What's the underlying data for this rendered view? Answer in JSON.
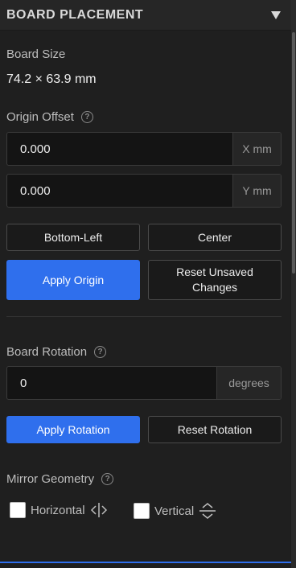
{
  "header": {
    "title": "BOARD PLACEMENT",
    "collapse_icon": "triangle-down-icon"
  },
  "board_size": {
    "label": "Board Size",
    "value": "74.2 × 63.9 mm"
  },
  "origin_offset": {
    "label": "Origin Offset",
    "help": "?",
    "x": {
      "value": "0.000",
      "suffix": "X mm"
    },
    "y": {
      "value": "0.000",
      "suffix": "Y mm"
    },
    "bottom_left_label": "Bottom-Left",
    "center_label": "Center",
    "apply_label": "Apply Origin",
    "reset_label": "Reset Unsaved Changes"
  },
  "board_rotation": {
    "label": "Board Rotation",
    "help": "?",
    "value": "0",
    "suffix": "degrees",
    "apply_label": "Apply Rotation",
    "reset_label": "Reset Rotation"
  },
  "mirror_geometry": {
    "label": "Mirror Geometry",
    "help": "?",
    "horizontal_label": "Horizontal",
    "vertical_label": "Vertical",
    "horizontal_checked": false,
    "vertical_checked": false
  },
  "colors": {
    "accent": "#2f6fed",
    "background": "#1f1f1f",
    "input_bg": "#141414"
  }
}
